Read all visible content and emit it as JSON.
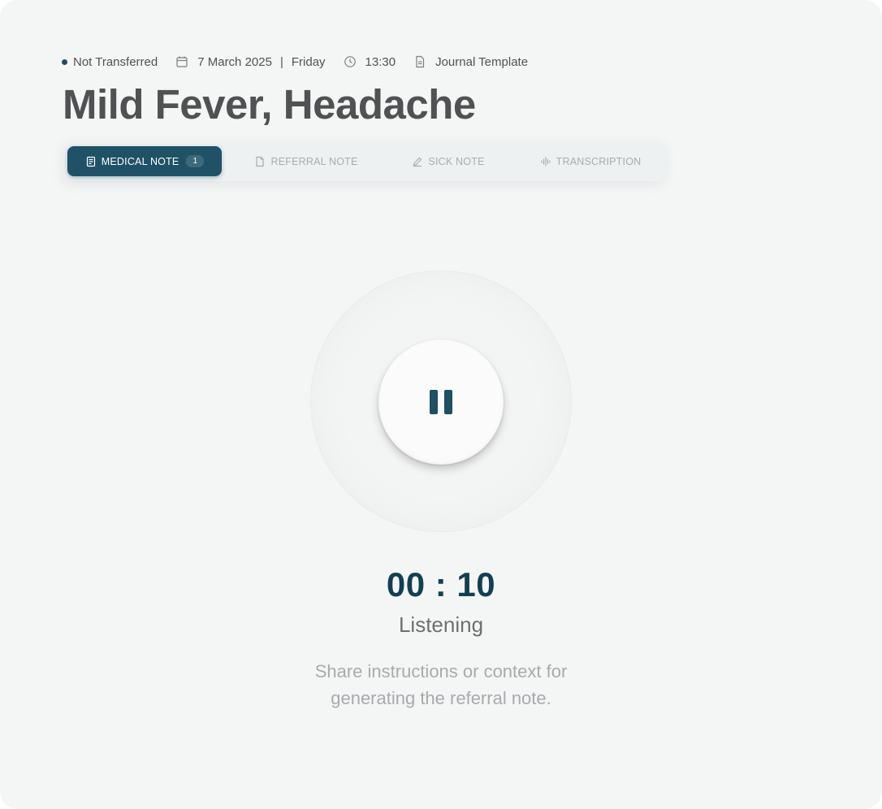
{
  "meta": {
    "status": "Not Transferred",
    "date": "7 March 2025",
    "separator": "|",
    "weekday": "Friday",
    "time": "13:30",
    "template": "Journal Template"
  },
  "title": "Mild Fever, Headache",
  "tabs": [
    {
      "label": "MEDICAL NOTE",
      "badge": "1",
      "icon": "clipboard-note-icon",
      "active": true
    },
    {
      "label": "REFERRAL NOTE",
      "icon": "document-icon",
      "active": false
    },
    {
      "label": "SICK NOTE",
      "icon": "pencil-icon",
      "active": false
    },
    {
      "label": "TRANSCRIPTION",
      "icon": "waveform-icon",
      "active": false
    }
  ],
  "recorder": {
    "timer": "00 : 10",
    "status": "Listening",
    "hint_line1": "Share instructions or context for",
    "hint_line2": "generating the referral note."
  },
  "colors": {
    "accent": "#1f5266",
    "timer": "#123f52",
    "background": "#f4f5f5"
  }
}
